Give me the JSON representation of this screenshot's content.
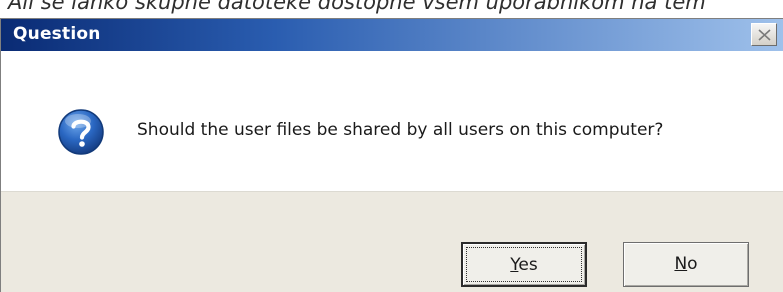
{
  "caption": {
    "text": "Ali se lahko skupne datoteke dostopne vsem uporabnikom na tem"
  },
  "dialog": {
    "title": "Question",
    "close_glyph": "×",
    "icon": "question-icon",
    "message": "Should the user files be shared by all users on this computer?"
  },
  "buttons": {
    "yes": {
      "mnemonic": "Y",
      "rest": "es"
    },
    "no": {
      "mnemonic": "N",
      "rest": "o"
    }
  },
  "colors": {
    "title_gradient_start": "#0a2b74",
    "title_gradient_end": "#9fc1eb",
    "footer_bg": "#ece9e0",
    "icon_blue": "#1f5fb3"
  }
}
